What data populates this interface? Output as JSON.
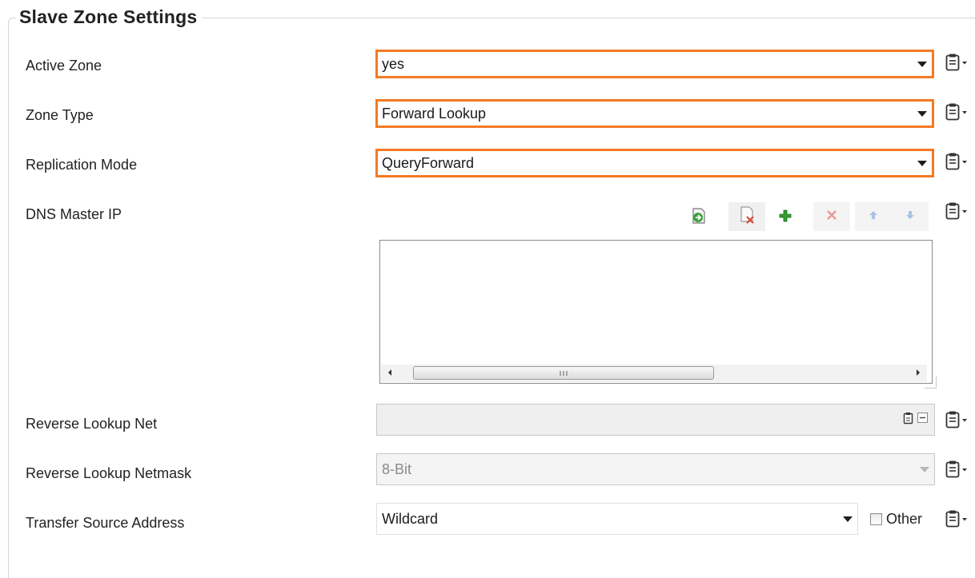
{
  "group": {
    "title": "Slave Zone Settings"
  },
  "fields": {
    "active_zone": {
      "label": "Active Zone",
      "value": "yes"
    },
    "zone_type": {
      "label": "Zone Type",
      "value": "Forward Lookup"
    },
    "replication_mode": {
      "label": "Replication Mode",
      "value": "QueryForward"
    },
    "dns_master_ip": {
      "label": "DNS Master IP",
      "items": []
    },
    "reverse_lookup_net": {
      "label": "Reverse Lookup Net",
      "value": ""
    },
    "reverse_lookup_netmask": {
      "label": "Reverse Lookup Netmask",
      "value": "8-Bit"
    },
    "transfer_source_address": {
      "label": "Transfer Source Address",
      "value": "Wildcard",
      "other_label": "Other",
      "other_checked": false
    }
  },
  "colors": {
    "highlight": "#f47a22",
    "add_green": "#2ea02e",
    "delete_red": "#e05050",
    "arrow_blue": "#8fb0e0"
  },
  "icons": [
    "clipboard-menu-icon",
    "import-icon",
    "clear-list-icon",
    "add-icon",
    "delete-icon",
    "move-up-icon",
    "move-down-icon",
    "scroll-left-icon",
    "scroll-right-icon",
    "clipboard-icon",
    "collapse-icon",
    "dropdown-arrow-icon"
  ]
}
